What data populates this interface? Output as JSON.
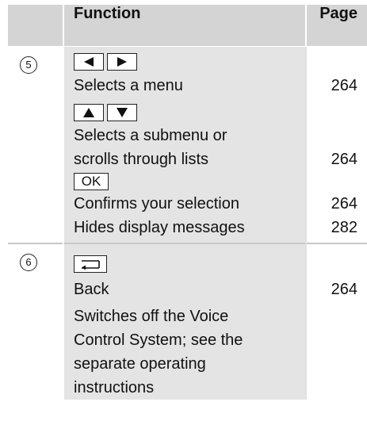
{
  "header": {
    "function_label": "Function",
    "page_label": "Page"
  },
  "groups": [
    {
      "index": "5",
      "keys": [
        {
          "icons": [
            "arrow-left-key-icon",
            "arrow-right-key-icon"
          ]
        },
        {
          "icons": [
            "arrow-up-key-icon",
            "arrow-down-key-icon"
          ]
        },
        {
          "label": "OK"
        }
      ],
      "items": [
        {
          "text": [
            "Selects a menu"
          ],
          "page": "264"
        },
        {
          "text": [
            "Selects a submenu or",
            "scrolls through lists"
          ],
          "page": "264"
        },
        {
          "text": [
            "Confirms your selection"
          ],
          "page": "264"
        },
        {
          "text": [
            "Hides display messages"
          ],
          "page": "282"
        }
      ]
    },
    {
      "index": "6",
      "keys": [
        {
          "icons": [
            "back-key-icon"
          ]
        }
      ],
      "items": [
        {
          "text": [
            "Back"
          ],
          "page": "264"
        },
        {
          "text": [
            "Switches off the Voice",
            "Control System; see the",
            "separate operating",
            "instructions"
          ],
          "page": ""
        }
      ]
    }
  ]
}
